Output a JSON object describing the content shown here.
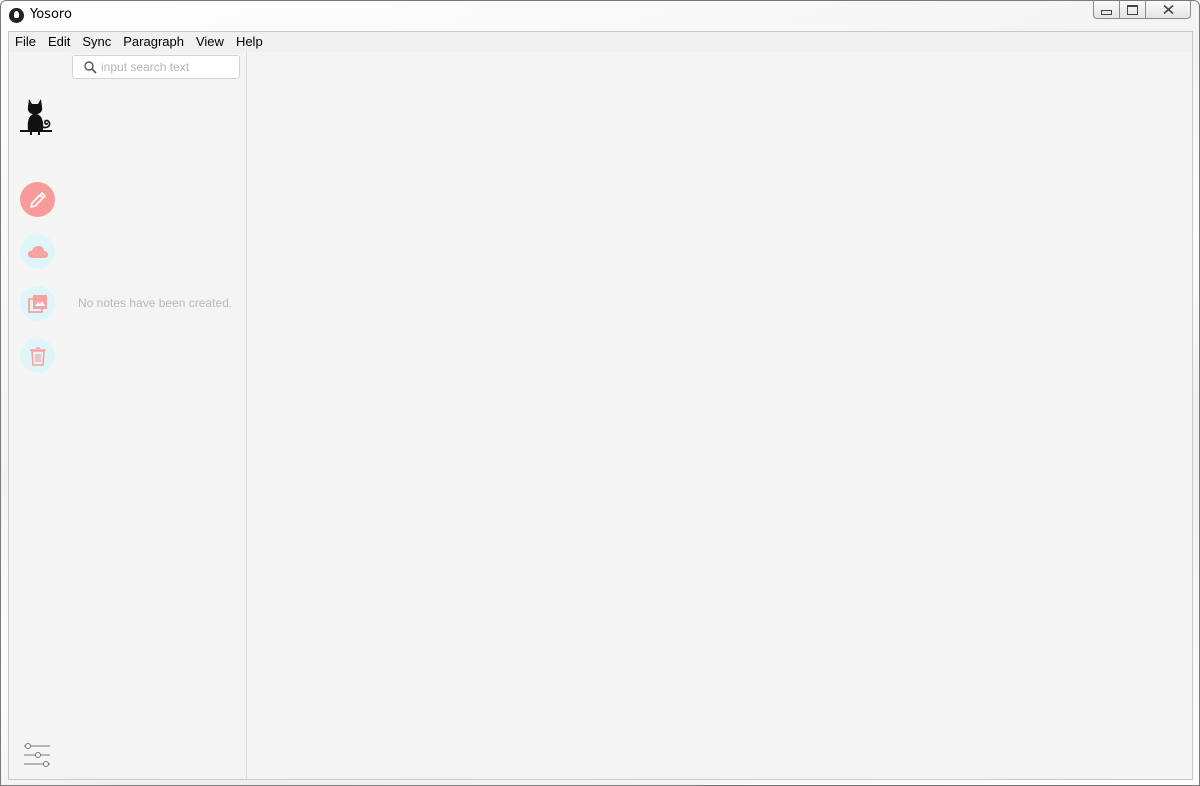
{
  "window": {
    "title": "Yosoro"
  },
  "menu": {
    "items": [
      "File",
      "Edit",
      "Sync",
      "Paragraph",
      "View",
      "Help"
    ]
  },
  "search": {
    "placeholder": "input search text",
    "value": ""
  },
  "notes": {
    "empty_message": "No notes have been created."
  },
  "rail": {
    "buttons": [
      {
        "name": "pencil-icon",
        "state": "active"
      },
      {
        "name": "cloud-icon",
        "state": "idle"
      },
      {
        "name": "image-icon",
        "state": "idle"
      },
      {
        "name": "trash-icon",
        "state": "idle"
      }
    ]
  },
  "colors": {
    "accent": "#f99b9b",
    "idle_button": "#def6f8",
    "icon_pink": "#f8a2a2"
  }
}
